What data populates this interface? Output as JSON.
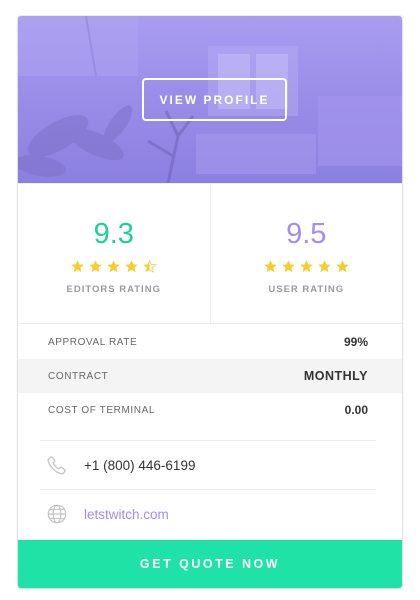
{
  "hero": {
    "view_profile_label": "VIEW PROFILE",
    "overlay_color": "#9b8ee9"
  },
  "ratings": [
    {
      "score": "9.3",
      "label": "EDITORS RATING",
      "stars": 4.5,
      "score_color": "#1fce9d"
    },
    {
      "score": "9.5",
      "label": "USER RATING",
      "stars": 5,
      "score_color": "#a48cf0"
    }
  ],
  "star_color": "#f5cf2a",
  "stats": [
    {
      "label": "APPROVAL RATE",
      "value": "99%"
    },
    {
      "label": "CONTRACT",
      "value": "MONTHLY"
    },
    {
      "label": "COST OF TERMINAL",
      "value": "0.00"
    }
  ],
  "contact": {
    "phone": "+1 (800) 446-6199",
    "website": "letstwitch.com",
    "phone_icon": "phone-icon",
    "website_icon": "globe-icon"
  },
  "cta": {
    "label": "GET QUOTE NOW",
    "color": "#1fe2a6"
  }
}
